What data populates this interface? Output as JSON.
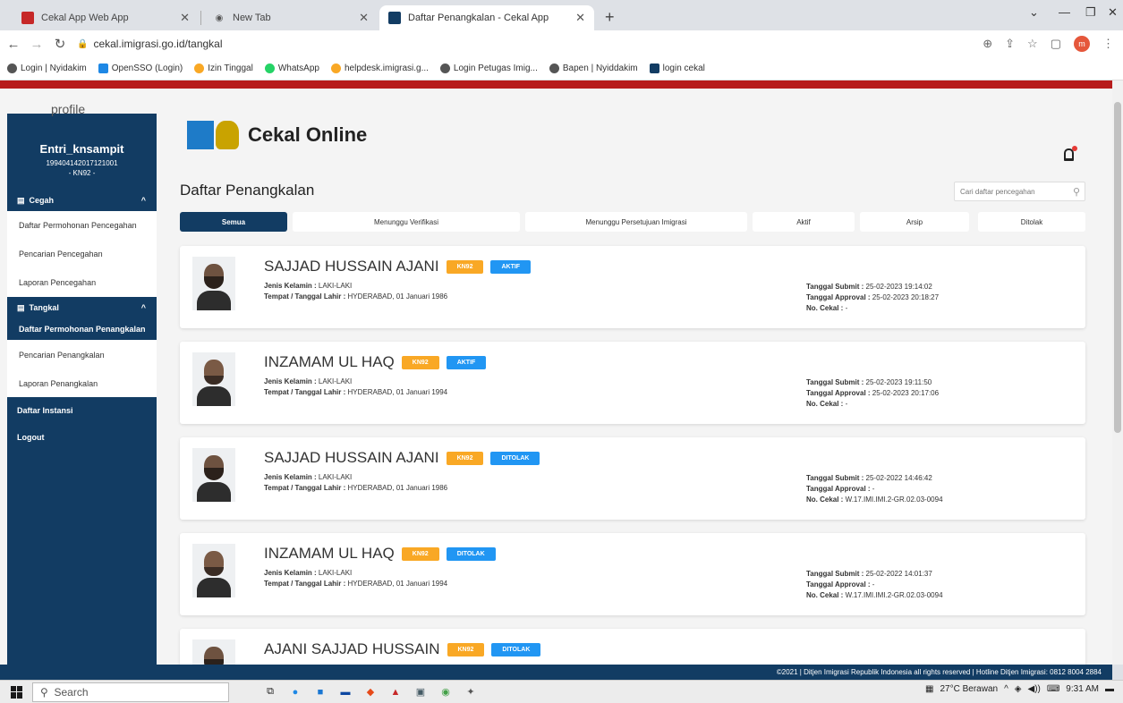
{
  "browser": {
    "tabs": [
      {
        "title": "Cekal App Web App",
        "icon_color": "#c62828",
        "active": false
      },
      {
        "title": "New Tab",
        "icon_color": "#555555",
        "active": false
      },
      {
        "title": "Daftar Penangkalan - Cekal App",
        "icon_color": "#123c63",
        "active": true
      }
    ],
    "new_tab": "+",
    "url": "cekal.imigrasi.go.id/tangkal",
    "profile_initial": "m",
    "bookmarks": [
      {
        "label": "Login | Nyidakim",
        "color": "#555555"
      },
      {
        "label": "OpenSSO (Login)",
        "color": "#1e88e5"
      },
      {
        "label": "Izin Tinggal",
        "color": "#f9a825"
      },
      {
        "label": "WhatsApp",
        "color": "#25d366"
      },
      {
        "label": "helpdesk.imigrasi.g...",
        "color": "#f9a825"
      },
      {
        "label": "Login Petugas Imig...",
        "color": "#555555"
      },
      {
        "label": "Bapen | Nyiddakim",
        "color": "#555555"
      },
      {
        "label": "login cekal",
        "color": "#123c63"
      }
    ]
  },
  "sidebar": {
    "profile_label": "profile",
    "user_name": "Entri_knsampit",
    "user_nip": "199404142017121001",
    "user_unit": "- KN92 -",
    "cegah": {
      "label": "Cegah",
      "items": [
        "Daftar Permohonan Pencegahan",
        "Pencarian Pencegahan",
        "Laporan Pencegahan"
      ]
    },
    "tangkal": {
      "label": "Tangkal",
      "items": [
        "Daftar Permohonan Penangkalan",
        "Pencarian Penangkalan",
        "Laporan Penangkalan"
      ]
    },
    "daftar_instansi": "Daftar Instansi",
    "logout": "Logout"
  },
  "header": {
    "app_title": "Cekal Online"
  },
  "main": {
    "title": "Daftar Penangkalan",
    "search_placeholder": "Cari daftar pencegahan",
    "tabs": [
      "Semua",
      "Menunggu Verifikasi",
      "Menunggu Persetujuan Imigrasi",
      "Aktif",
      "Arsip",
      "Ditolak"
    ],
    "active_tab": "Semua",
    "labels": {
      "gender": "Jenis Kelamin :",
      "birth": "Tempat / Tanggal Lahir :",
      "submit": "Tanggal Submit :",
      "approval": "Tanggal Approval :",
      "no_cekal": "No. Cekal :"
    },
    "records": [
      {
        "name": "SAJJAD HUSSAIN AJANI",
        "unit": "KN92",
        "status": "AKTIF",
        "gender": "LAKI-LAKI",
        "birth": "HYDERABAD, 01 Januari 1986",
        "submit": "25-02-2023 19:14:02",
        "approval": "25-02-2023 20:18:27",
        "no_cekal": "-"
      },
      {
        "name": "INZAMAM UL HAQ",
        "unit": "KN92",
        "status": "AKTIF",
        "gender": "LAKI-LAKI",
        "birth": "HYDERABAD, 01 Januari 1994",
        "submit": "25-02-2023 19:11:50",
        "approval": "25-02-2023 20:17:06",
        "no_cekal": "-"
      },
      {
        "name": "SAJJAD HUSSAIN AJANI",
        "unit": "KN92",
        "status": "DITOLAK",
        "gender": "LAKI-LAKI",
        "birth": "HYDERABAD, 01 Januari 1986",
        "submit": "25-02-2022 14:46:42",
        "approval": "-",
        "no_cekal": "W.17.IMI.IMI.2-GR.02.03-0094"
      },
      {
        "name": "INZAMAM UL HAQ",
        "unit": "KN92",
        "status": "DITOLAK",
        "gender": "LAKI-LAKI",
        "birth": "HYDERABAD, 01 Januari 1994",
        "submit": "25-02-2022 14:01:37",
        "approval": "-",
        "no_cekal": "W.17.IMI.IMI.2-GR.02.03-0094"
      },
      {
        "name": "AJANI SAJJAD HUSSAIN",
        "unit": "KN92",
        "status": "DITOLAK"
      }
    ]
  },
  "footer": {
    "copyright": "©2021 | Ditjen Imigrasi Republik Indonesia all rights reserved | Hotline Ditjen Imigrasi: 0812 8004 2884"
  },
  "taskbar": {
    "search": "Search",
    "weather": "27°C  Berawan",
    "time": "9:31 AM"
  },
  "colors": {
    "brand_navy": "#123c63",
    "top_bar_red": "#b71c1c",
    "badge_unit": "#f9a825",
    "badge_status": "#2196f3"
  }
}
